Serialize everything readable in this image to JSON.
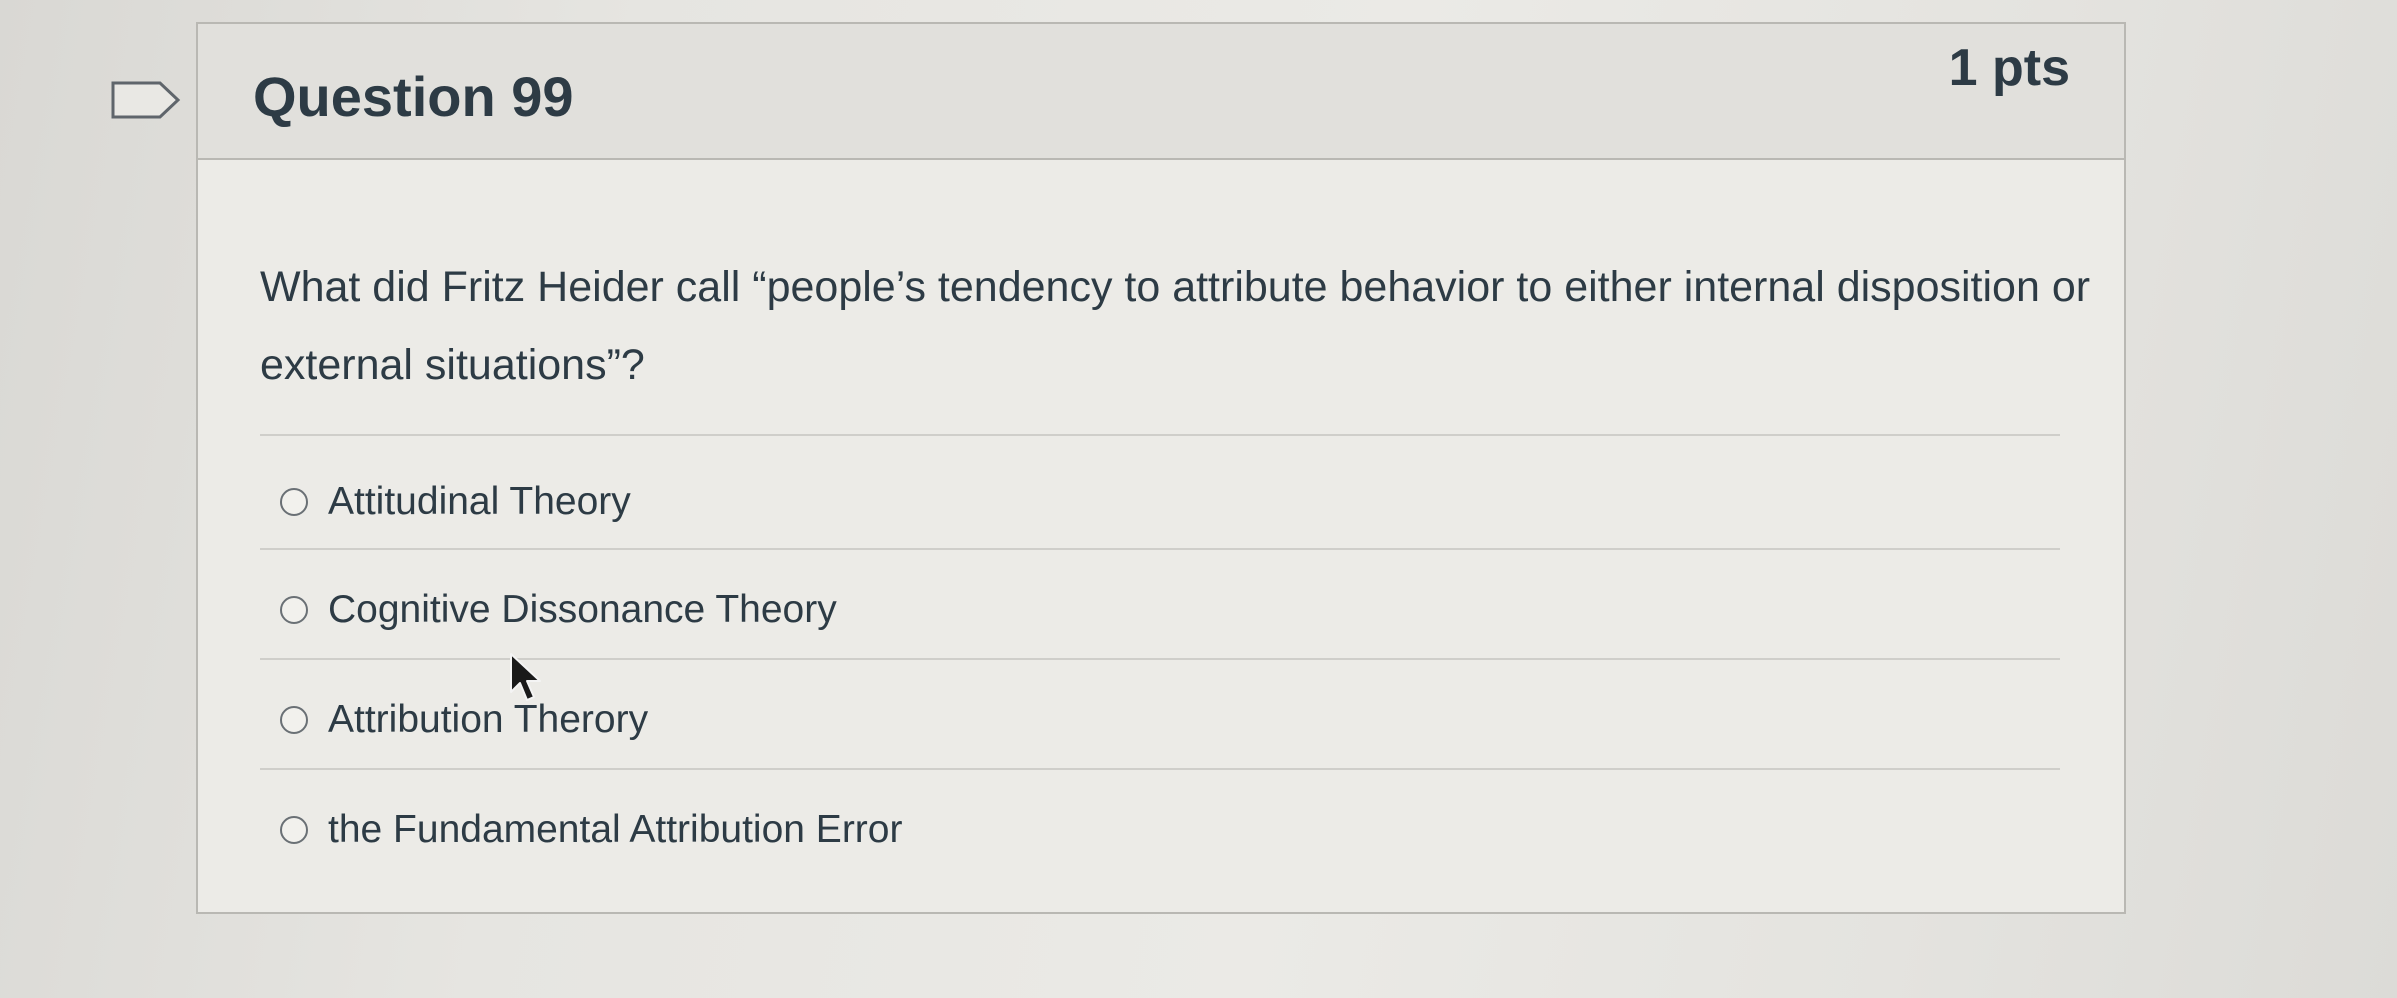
{
  "question": {
    "title": "Question 99",
    "points": "1 pts",
    "text": "What did Fritz Heider call “people’s tendency to attribute behavior to either internal disposition or external situations”?",
    "answers": [
      {
        "label": "Attitudinal Theory",
        "selected": false
      },
      {
        "label": "Cognitive Dissonance Theory",
        "selected": false
      },
      {
        "label": "Attribution Therory",
        "selected": false
      },
      {
        "label": "the Fundamental Attribution Error",
        "selected": false
      }
    ]
  },
  "icons": {
    "flag": "flag-question-icon",
    "cursor": "mouse-pointer-icon"
  },
  "colors": {
    "text": "#2d3b45",
    "header_bg": "#e1e0dc",
    "border": "#b9b8b3"
  }
}
